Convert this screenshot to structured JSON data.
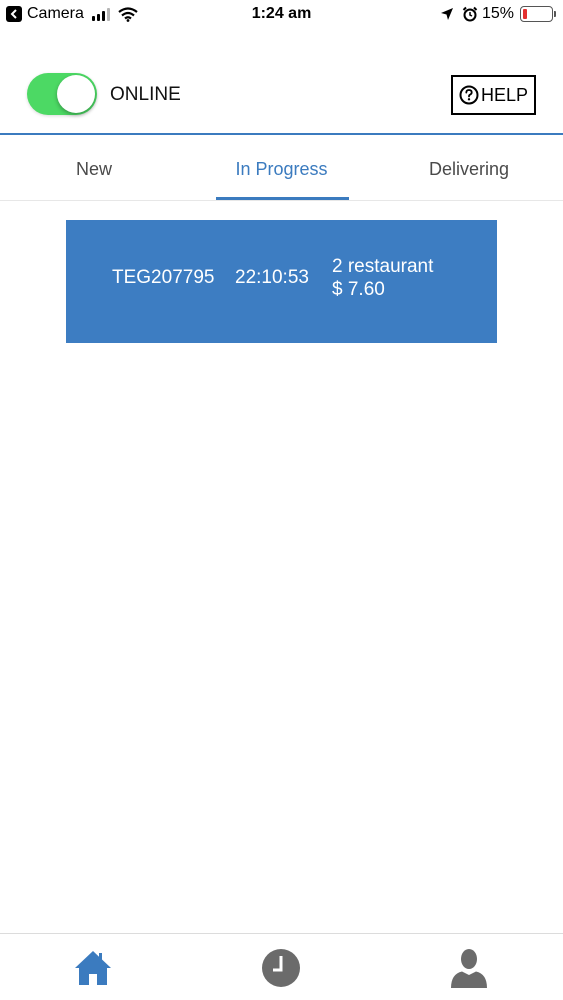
{
  "status_bar": {
    "back_app": "Camera",
    "time": "1:24 am",
    "battery_percent": "15%",
    "battery_level": 0.15,
    "icons": [
      "back-icon",
      "cellular-signal-icon",
      "wifi-icon",
      "location-arrow-icon",
      "alarm-icon",
      "battery-icon"
    ]
  },
  "header": {
    "online_toggle_on": true,
    "online_label": "ONLINE",
    "help_label": "HELP",
    "help_icon": "question-circle-icon"
  },
  "tabs": [
    {
      "label": "New",
      "active": false
    },
    {
      "label": "In Progress",
      "active": true
    },
    {
      "label": "Delivering",
      "active": false
    }
  ],
  "orders": [
    {
      "id": "TEG207795",
      "time": "22:10:53",
      "restaurants": "2 restaurant",
      "price": "$ 7.60"
    }
  ],
  "bottom_nav": {
    "items": [
      {
        "icon": "home-icon",
        "active": true
      },
      {
        "icon": "clock-icon",
        "active": false
      },
      {
        "icon": "user-icon",
        "active": false
      }
    ]
  },
  "colors": {
    "accent": "#3b7bbf",
    "card": "#3d7dc2",
    "toggle_on": "#4cd964",
    "nav_inactive": "#6b6b6b"
  }
}
